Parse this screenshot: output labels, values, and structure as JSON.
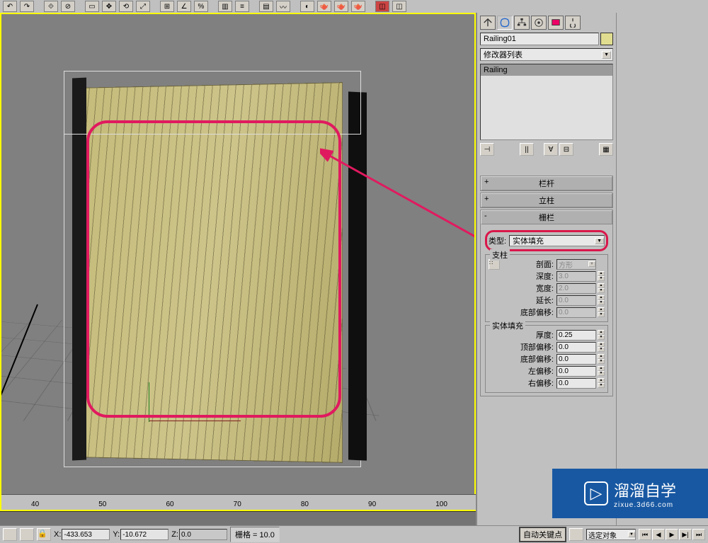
{
  "toolbar": {
    "tooltip": "Main Toolbar"
  },
  "object": {
    "name": "Railing01",
    "modifier_list_label": "修改器列表",
    "stack_item": "Railing"
  },
  "rollouts": {
    "r1": "栏杆",
    "r2": "立柱",
    "r3": "栅栏"
  },
  "type_section": {
    "label": "类型:",
    "value": "实体填充"
  },
  "pillar_group": {
    "title": "支柱",
    "profile_label": "剖面:",
    "profile_value": "方形",
    "depth_label": "深度:",
    "depth_value": "3.0",
    "width_label": "宽度:",
    "width_value": "2.0",
    "ext_label": "延长:",
    "ext_value": "0.0",
    "bottom_label": "底部偏移:",
    "bottom_value": "0.0"
  },
  "fill_group": {
    "title": "实体填充",
    "thick_label": "厚度:",
    "thick_value": "0.25",
    "top_label": "顶部偏移:",
    "top_value": "0.0",
    "bottom_label": "底部偏移:",
    "bottom_value": "0.0",
    "left_label": "左偏移:",
    "left_value": "0.0",
    "right_label": "右偏移:",
    "right_value": "0.0"
  },
  "ruler": [
    "40",
    "50",
    "60",
    "70",
    "80",
    "90",
    "100"
  ],
  "status": {
    "x_label": "X:",
    "x_value": "-433.653",
    "y_label": "Y:",
    "y_value": "-10.672",
    "z_label": "Z:",
    "z_value": "0.0",
    "grid": "栅格 = 10.0",
    "auto_key": "自动关键点",
    "selection_filter": "选定对象"
  },
  "watermark": {
    "title": "溜溜自学",
    "sub": "zixue.3d66.com"
  }
}
